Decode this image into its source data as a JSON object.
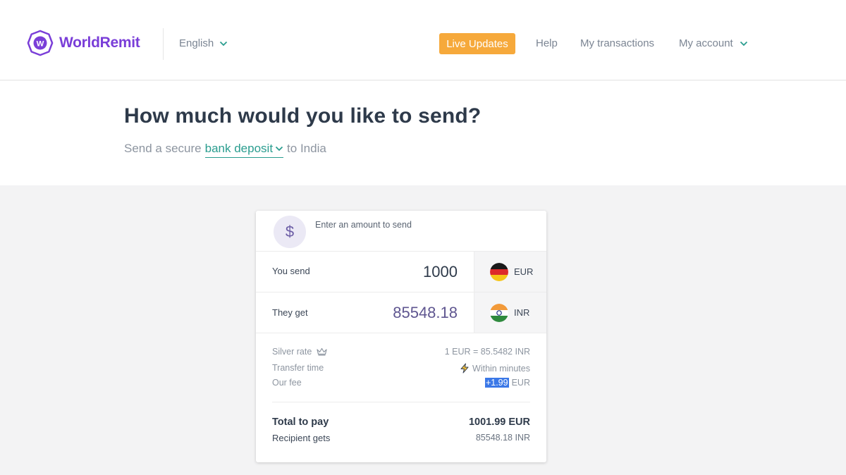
{
  "brand": {
    "name": "WorldRemit",
    "mark": "W",
    "color": "#7a3ed8"
  },
  "nav": {
    "language": "English",
    "live_updates": "Live Updates",
    "help": "Help",
    "transactions": "My transactions",
    "account": "My account"
  },
  "hero": {
    "title": "How much would you like to send?",
    "prefix": "Send a secure",
    "method": "bank deposit",
    "suffix": "to India"
  },
  "calculator": {
    "header_icon": "$",
    "header_text": "Enter an amount to send",
    "send": {
      "label": "You send",
      "amount": "1000",
      "currency": "EUR",
      "flag": "germany-flag-icon"
    },
    "receive": {
      "label": "They get",
      "amount": "85548.18",
      "currency": "INR",
      "flag": "india-flag-icon"
    },
    "rate": {
      "label": "Silver rate",
      "icon": "crown-icon",
      "value": "1 EUR = 85.5482 INR"
    },
    "transfer": {
      "label": "Transfer time",
      "icon": "lightning-icon",
      "value": "Within minutes"
    },
    "fee": {
      "label": "Our fee",
      "amount": "+1.99",
      "currency": "EUR"
    },
    "total": {
      "label": "Total to pay",
      "value": "1001.99 EUR"
    },
    "recipient": {
      "label": "Recipient gets",
      "value": "85548.18 INR"
    }
  },
  "colors": {
    "accent": "#f6a93b",
    "link": "#2a9d8f",
    "highlight": "#3b78e7"
  }
}
